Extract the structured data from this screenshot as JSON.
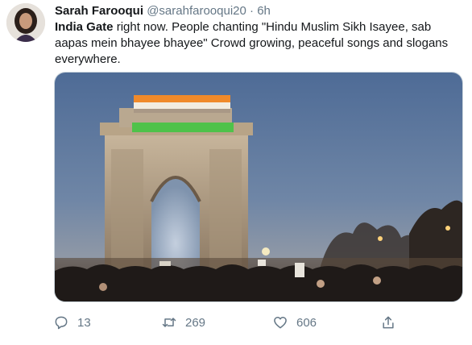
{
  "tweet": {
    "author_name": "Sarah Farooqui",
    "author_handle": "@sarahfarooqui20",
    "separator": "·",
    "time_ago": "6h",
    "text_lead": "India Gate",
    "text_body": " right now. People chanting \"Hindu Muslim Sikh Isayee, sab aapas mein bhayee bhayee\" Crowd growing, peaceful songs and slogans everywhere.",
    "media_description": "India Gate illuminated at night with a large crowd"
  },
  "actions": {
    "reply": {
      "icon": "reply-icon",
      "count": "13"
    },
    "retweet": {
      "icon": "retweet-icon",
      "count": "269"
    },
    "like": {
      "icon": "heart-icon",
      "count": "606"
    },
    "share": {
      "icon": "share-icon"
    }
  },
  "colors": {
    "text": "#14171a",
    "muted": "#657786",
    "link": "#1da1f2",
    "border": "#ccd6dd"
  }
}
